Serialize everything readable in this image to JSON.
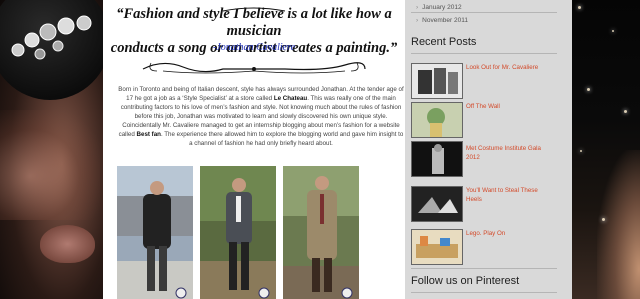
{
  "quote": {
    "line1": "“Fashion and style I believe is a lot like how a musician",
    "line2": "conducts a song or an artist creates a painting.”",
    "attribution": "-Jonathan Cavaliere"
  },
  "article": {
    "p1": "Born in Toronto and being of Italian descent, style has always surrounded Jonathan.  At the tender age of 17 he got a job as a ‘Style Specialist’ at a store called ",
    "store": "Le Chateau",
    "p2": ". This was really one of the main contributing factors to his love of men’s fashion and style. Not knowing much about the rules of fashion before this job, Jonathan was motivated to learn and slowly discovered his own unique style. Coincidentally Mr. Cavaliere managed to get an internship blogging about men’s fashion for a website called ",
    "site": "Best fan",
    "p3": ". The experience there allowed him to explore the blogging world and gave him insight to a channel of fashion he had only briefly heard about."
  },
  "sidebar": {
    "archive": [
      "January 2012",
      "November 2011"
    ],
    "recent_title": "Recent Posts",
    "posts": [
      {
        "label": "Look Out for Mr. Cavaliere"
      },
      {
        "label": "Off The Wall"
      },
      {
        "label": "Met Costume Institute Gala 2012"
      },
      {
        "label": "You'll Want to Steal These Heels"
      },
      {
        "label": "Lego. Play On"
      }
    ],
    "pinterest_title": "Follow us on Pinterest"
  },
  "colors": {
    "link": "#d34a2a",
    "attribution": "#2233bb",
    "sidebar_bg": "#d9d9d9"
  }
}
